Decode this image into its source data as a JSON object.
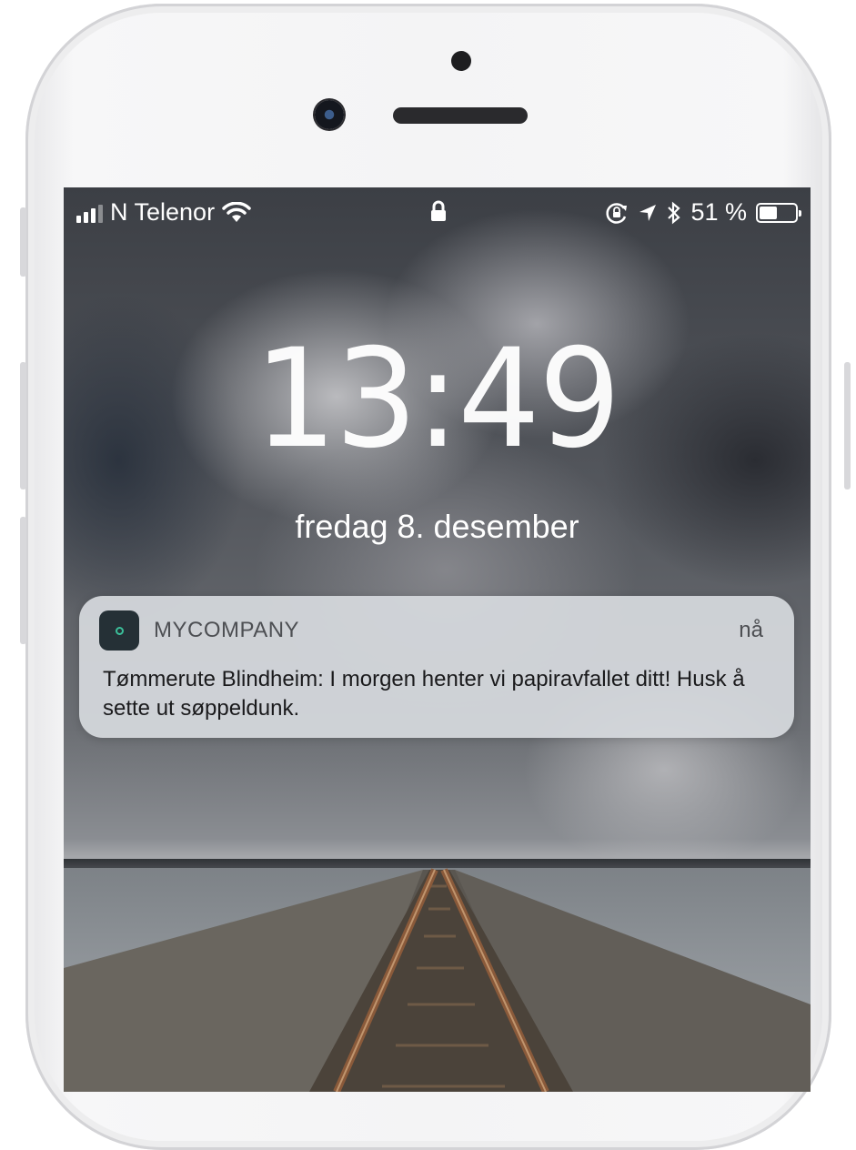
{
  "status_bar": {
    "carrier": "N Telenor",
    "battery_percent": "51 %",
    "battery_level": 0.51,
    "icons": [
      "signal-icon",
      "wifi-icon",
      "lock-icon",
      "orientation-lock-icon",
      "location-icon",
      "bluetooth-icon",
      "battery-icon"
    ]
  },
  "lock_screen": {
    "time": "13:49",
    "date": "fredag 8. desember"
  },
  "notification": {
    "app_name": "MYCOMPANY",
    "time": "nå",
    "message": "Tømmerute Blindheim: I morgen henter vi papiravfallet ditt! Husk å sette ut søppeldunk.",
    "icon_color": "#253036",
    "icon_accent": "#3bbf9a"
  }
}
